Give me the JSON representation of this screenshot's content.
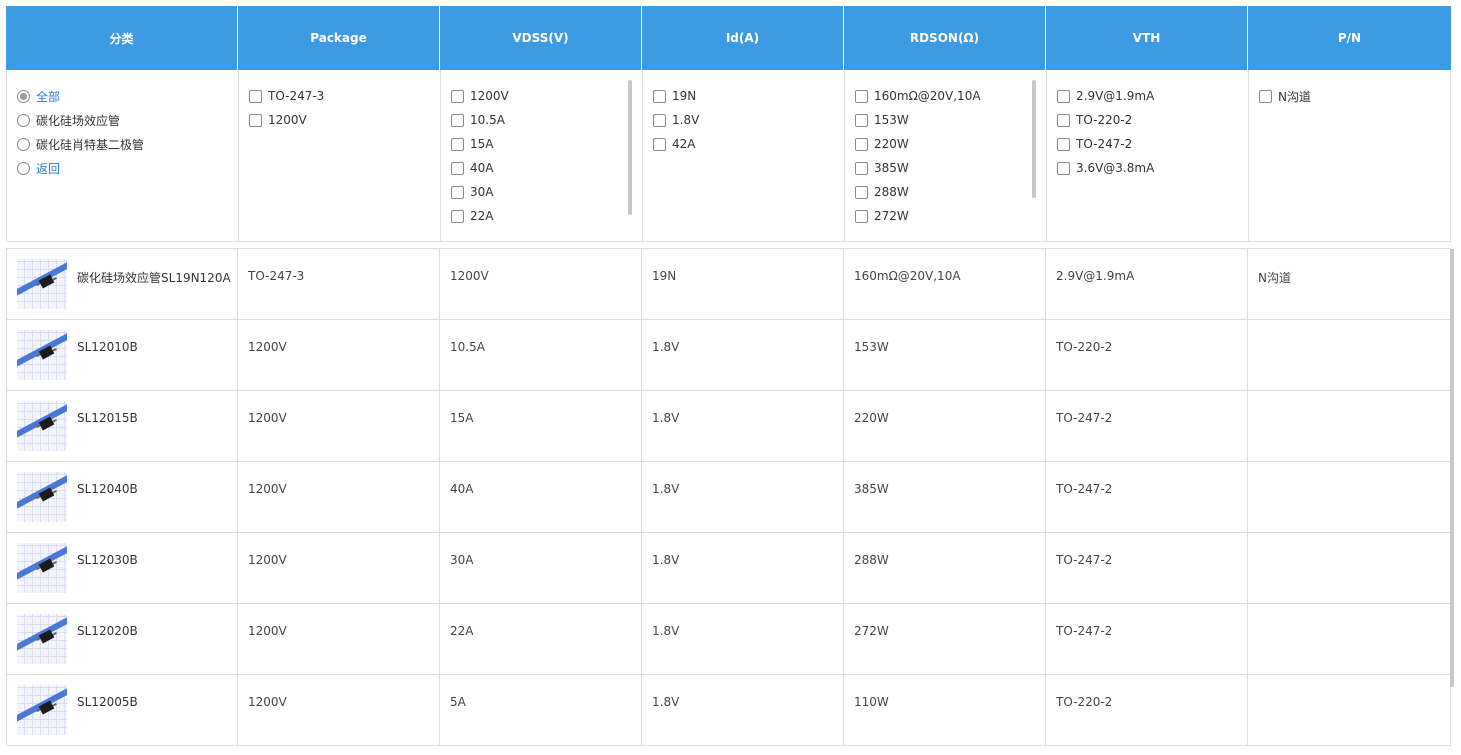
{
  "header": {
    "category": "分类",
    "package": "Package",
    "vdss": "VDSS(V)",
    "id": "Id(A)",
    "rdson": "RDSON(Ω)",
    "vth": "VTH",
    "pn": "P/N"
  },
  "filters": {
    "category": [
      "全部",
      "碳化硅场效应管",
      "碳化硅肖特基二极管",
      "返回"
    ],
    "package": [
      "TO-247-3",
      "1200V"
    ],
    "vdss": [
      "1200V",
      "10.5A",
      "15A",
      "40A",
      "30A",
      "22A"
    ],
    "id": [
      "19N",
      "1.8V",
      "42A"
    ],
    "rdson": [
      "160mΩ@20V,10A",
      "153W",
      "220W",
      "385W",
      "288W",
      "272W"
    ],
    "vth": [
      "2.9V@1.9mA",
      "TO-220-2",
      "TO-247-2",
      "3.6V@3.8mA"
    ],
    "pn": [
      "N沟道"
    ]
  },
  "rows": [
    {
      "name": "碳化硅场效应管SL19N120A",
      "package": "TO-247-3",
      "vdss": "1200V",
      "id": "19N",
      "rdson": "160mΩ@20V,10A",
      "vth": "2.9V@1.9mA",
      "pn": "N沟道"
    },
    {
      "name": "SL12010B",
      "package": "1200V",
      "vdss": "10.5A",
      "id": "1.8V",
      "rdson": "153W",
      "vth": "TO-220-2",
      "pn": ""
    },
    {
      "name": "SL12015B",
      "package": "1200V",
      "vdss": "15A",
      "id": "1.8V",
      "rdson": "220W",
      "vth": "TO-247-2",
      "pn": ""
    },
    {
      "name": "SL12040B",
      "package": "1200V",
      "vdss": "40A",
      "id": "1.8V",
      "rdson": "385W",
      "vth": "TO-247-2",
      "pn": ""
    },
    {
      "name": "SL12030B",
      "package": "1200V",
      "vdss": "30A",
      "id": "1.8V",
      "rdson": "288W",
      "vth": "TO-247-2",
      "pn": ""
    },
    {
      "name": "SL12020B",
      "package": "1200V",
      "vdss": "22A",
      "id": "1.8V",
      "rdson": "272W",
      "vth": "TO-247-2",
      "pn": ""
    },
    {
      "name": "SL12005B",
      "package": "1200V",
      "vdss": "5A",
      "id": "1.8V",
      "rdson": "110W",
      "vth": "TO-220-2",
      "pn": ""
    }
  ],
  "colors": {
    "header_bg": "#3d9be3",
    "link_blue": "#2b7bd0"
  }
}
